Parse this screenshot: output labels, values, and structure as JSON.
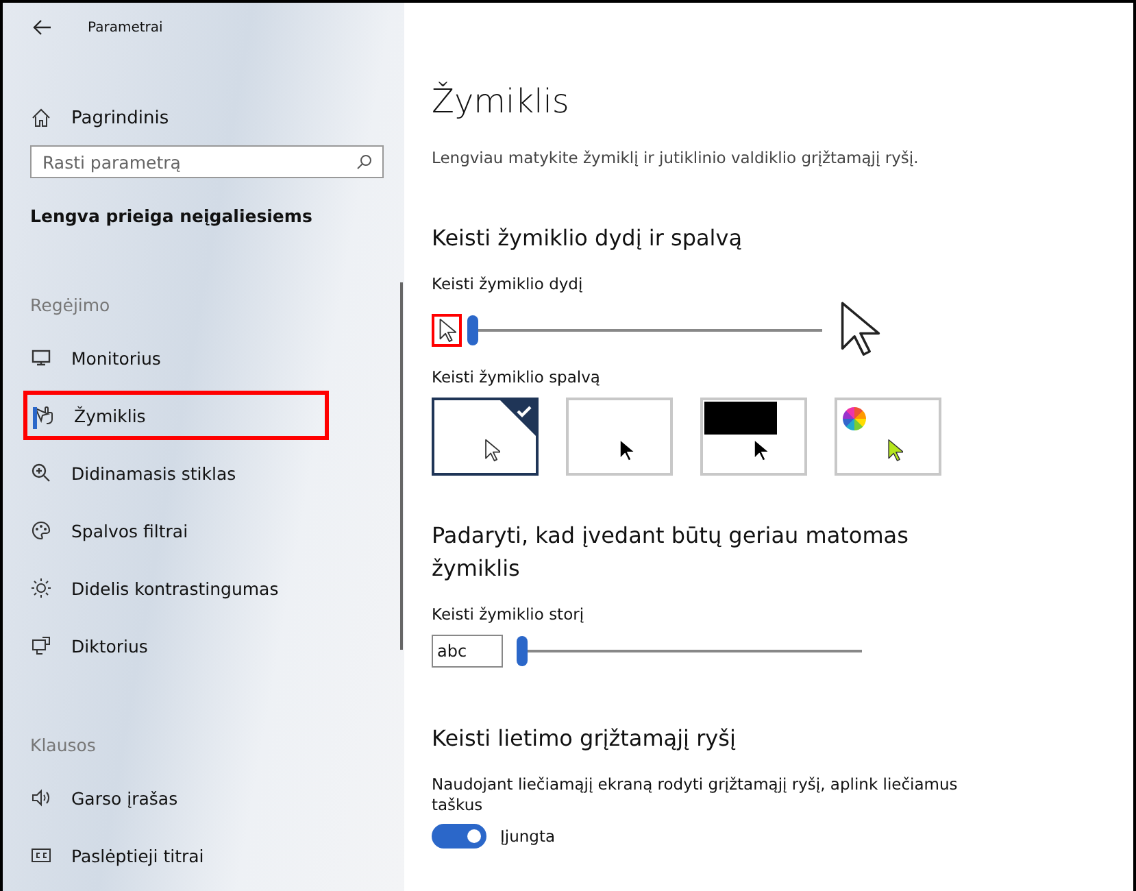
{
  "window": {
    "title": "Parametrai"
  },
  "sidebar": {
    "home": "Pagrindinis",
    "search": {
      "placeholder": "Rasti parametrą"
    },
    "heading": "Lengva prieiga neįgaliesiems",
    "groups": [
      {
        "title": "Regėjimo",
        "items": [
          {
            "label": "Monitorius",
            "selected": false,
            "highlighted": false
          },
          {
            "label": "Žymiklis",
            "selected": true,
            "highlighted": true
          },
          {
            "label": "Didinamasis stiklas",
            "selected": false,
            "highlighted": false
          },
          {
            "label": "Spalvos filtrai",
            "selected": false,
            "highlighted": false
          },
          {
            "label": "Didelis kontrastingumas",
            "selected": false,
            "highlighted": false
          },
          {
            "label": "Diktorius",
            "selected": false,
            "highlighted": false
          }
        ]
      },
      {
        "title": "Klausos",
        "items": [
          {
            "label": "Garso įrašas",
            "selected": false,
            "highlighted": false
          },
          {
            "label": "Paslėptieji titrai",
            "selected": false,
            "highlighted": false
          }
        ]
      }
    ]
  },
  "content": {
    "title": "Žymiklis",
    "subtitle": "Lengviau matykite žymiklį ir jutiklinio valdiklio grįžtamąjį ryšį.",
    "size_section": {
      "heading": "Keisti žymiklio dydį ir spalvą",
      "size_label": "Keisti žymiklio dydį",
      "size_slider": {
        "level": 0.0,
        "small_icon_highlighted": true
      },
      "color_label": "Keisti žymiklio spalvą",
      "colors": [
        {
          "kind": "white",
          "selected": true
        },
        {
          "kind": "black",
          "selected": false
        },
        {
          "kind": "inverted",
          "selected": false
        },
        {
          "kind": "custom",
          "selected": false
        }
      ]
    },
    "typing_section": {
      "heading": "Padaryti, kad įvedant būtų geriau matomas žymiklis",
      "thickness_label": "Keisti žymiklio storį",
      "preview": "abc",
      "thickness_slider": {
        "level": 0.0
      }
    },
    "touch_section": {
      "heading": "Keisti lietimo grįžtamąjį ryšį",
      "description": "Naudojant liečiamąjį ekraną rodyti grįžtamąjį ryšį, aplink liečiamus taškus",
      "toggle": {
        "on": true,
        "label": "Įjungta"
      }
    }
  }
}
